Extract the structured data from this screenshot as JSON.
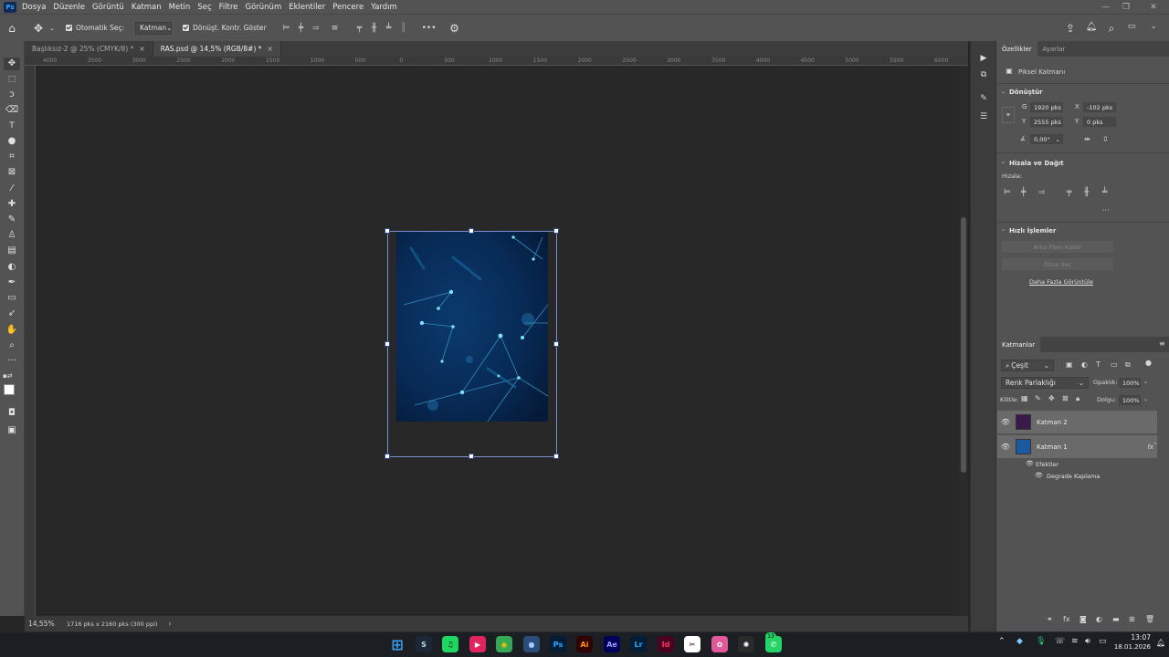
{
  "app": {
    "logo": "Ps",
    "menu": [
      "Dosya",
      "Düzenle",
      "Görüntü",
      "Katman",
      "Metin",
      "Seç",
      "Filtre",
      "Görünüm",
      "Eklentiler",
      "Pencere",
      "Yardım"
    ]
  },
  "options_bar": {
    "auto_select_label": "Otomatik Seç:",
    "auto_select_value": "Katman",
    "show_transform_label": "Dönüşt. Kontr. Göster",
    "more_label": "•••"
  },
  "tabs": [
    {
      "label": "Başlıksız-2 @ 25% (CMYK/8) *",
      "close": "×"
    },
    {
      "label": "RAS.psd @ 14,5% (RGB/8#) *",
      "close": "×"
    }
  ],
  "ruler_top_labels": [
    "4000",
    "3500",
    "3000",
    "2500",
    "2000",
    "1500",
    "1000",
    "500",
    "0",
    "500",
    "1000",
    "1500",
    "2000",
    "2500",
    "3000",
    "3500",
    "4000",
    "4500",
    "5000",
    "5500",
    "6000"
  ],
  "status": {
    "zoom": "14,55%",
    "doc_info": "1716 pks x 2160 pks (300 ppi)",
    "arrow": "›"
  },
  "properties": {
    "tab_properties": "Özellikler",
    "tab_adjustments": "Ayarlar",
    "layer_kind": "Piksel Katmanı",
    "transform_title": "Dönüştür",
    "w_label": "G",
    "w_value": "1920 pks",
    "x_label": "X",
    "x_value": "-102 pks",
    "h_label": "Y",
    "h_value": "2555 pks",
    "y_label": "Y",
    "y_value": "0 pks",
    "angle_value": "0,00°",
    "align_title": "Hizala ve Dağıt",
    "align_sub": "Hizala:",
    "quick_title": "Hızlı İşlemler",
    "quick_btn1": "Arka Planı Kaldır",
    "quick_btn2": "Özne Seç",
    "quick_link": "Daha Fazla Görüntüle"
  },
  "layers": {
    "title": "Katmanlar",
    "filter_value": "Çeşit",
    "blend_mode": "Renk Parlaklığı",
    "opacity_label": "Opaklık:",
    "opacity_value": "100%",
    "lock_label": "Kilitle:",
    "fill_label": "Dolgu:",
    "fill_value": "100%",
    "items": [
      {
        "name": "Katman 2",
        "thumb_color": "#3a1a4a"
      },
      {
        "name": "Katman 1",
        "thumb_color": "#1a5aa0",
        "fx": "fx"
      }
    ],
    "effects_label": "Efektler",
    "effect_item": "Degrade Kaplama"
  },
  "taskbar": {
    "time": "13:07",
    "date": "18.01.2026",
    "badge": "13",
    "apps": [
      {
        "name": "windows",
        "glyph": "⊞",
        "color": "#3aa0f5",
        "bg": "transparent"
      },
      {
        "name": "steam",
        "glyph": "S",
        "color": "#c7d5e0",
        "bg": "#1b2838"
      },
      {
        "name": "spotify",
        "glyph": "♫",
        "color": "#111",
        "bg": "#1ed760"
      },
      {
        "name": "media",
        "glyph": "▶",
        "color": "#fff",
        "bg": "#e0245e"
      },
      {
        "name": "chrome",
        "glyph": "◉",
        "color": "#fbbc05",
        "bg": "#34a853"
      },
      {
        "name": "app-blue",
        "glyph": "●",
        "color": "#9ecbff",
        "bg": "#2b4d7a"
      },
      {
        "name": "photoshop",
        "glyph": "Ps",
        "color": "#31a8ff",
        "bg": "#001e36"
      },
      {
        "name": "illustrator",
        "glyph": "Ai",
        "color": "#ff9a00",
        "bg": "#330000"
      },
      {
        "name": "after-effects",
        "glyph": "Ae",
        "color": "#9999ff",
        "bg": "#00005b"
      },
      {
        "name": "lightroom",
        "glyph": "Lr",
        "color": "#31a8ff",
        "bg": "#001e36"
      },
      {
        "name": "indesign",
        "glyph": "Id",
        "color": "#ff3366",
        "bg": "#49021f"
      },
      {
        "name": "capcut",
        "glyph": "✂",
        "color": "#111",
        "bg": "#ffffff"
      },
      {
        "name": "photos",
        "glyph": "✿",
        "color": "#fff",
        "bg": "#e05a9a"
      },
      {
        "name": "openai",
        "glyph": "✺",
        "color": "#fff",
        "bg": "#2a2a2a"
      },
      {
        "name": "whatsapp",
        "glyph": "✆",
        "color": "#fff",
        "bg": "#25d366"
      }
    ]
  }
}
